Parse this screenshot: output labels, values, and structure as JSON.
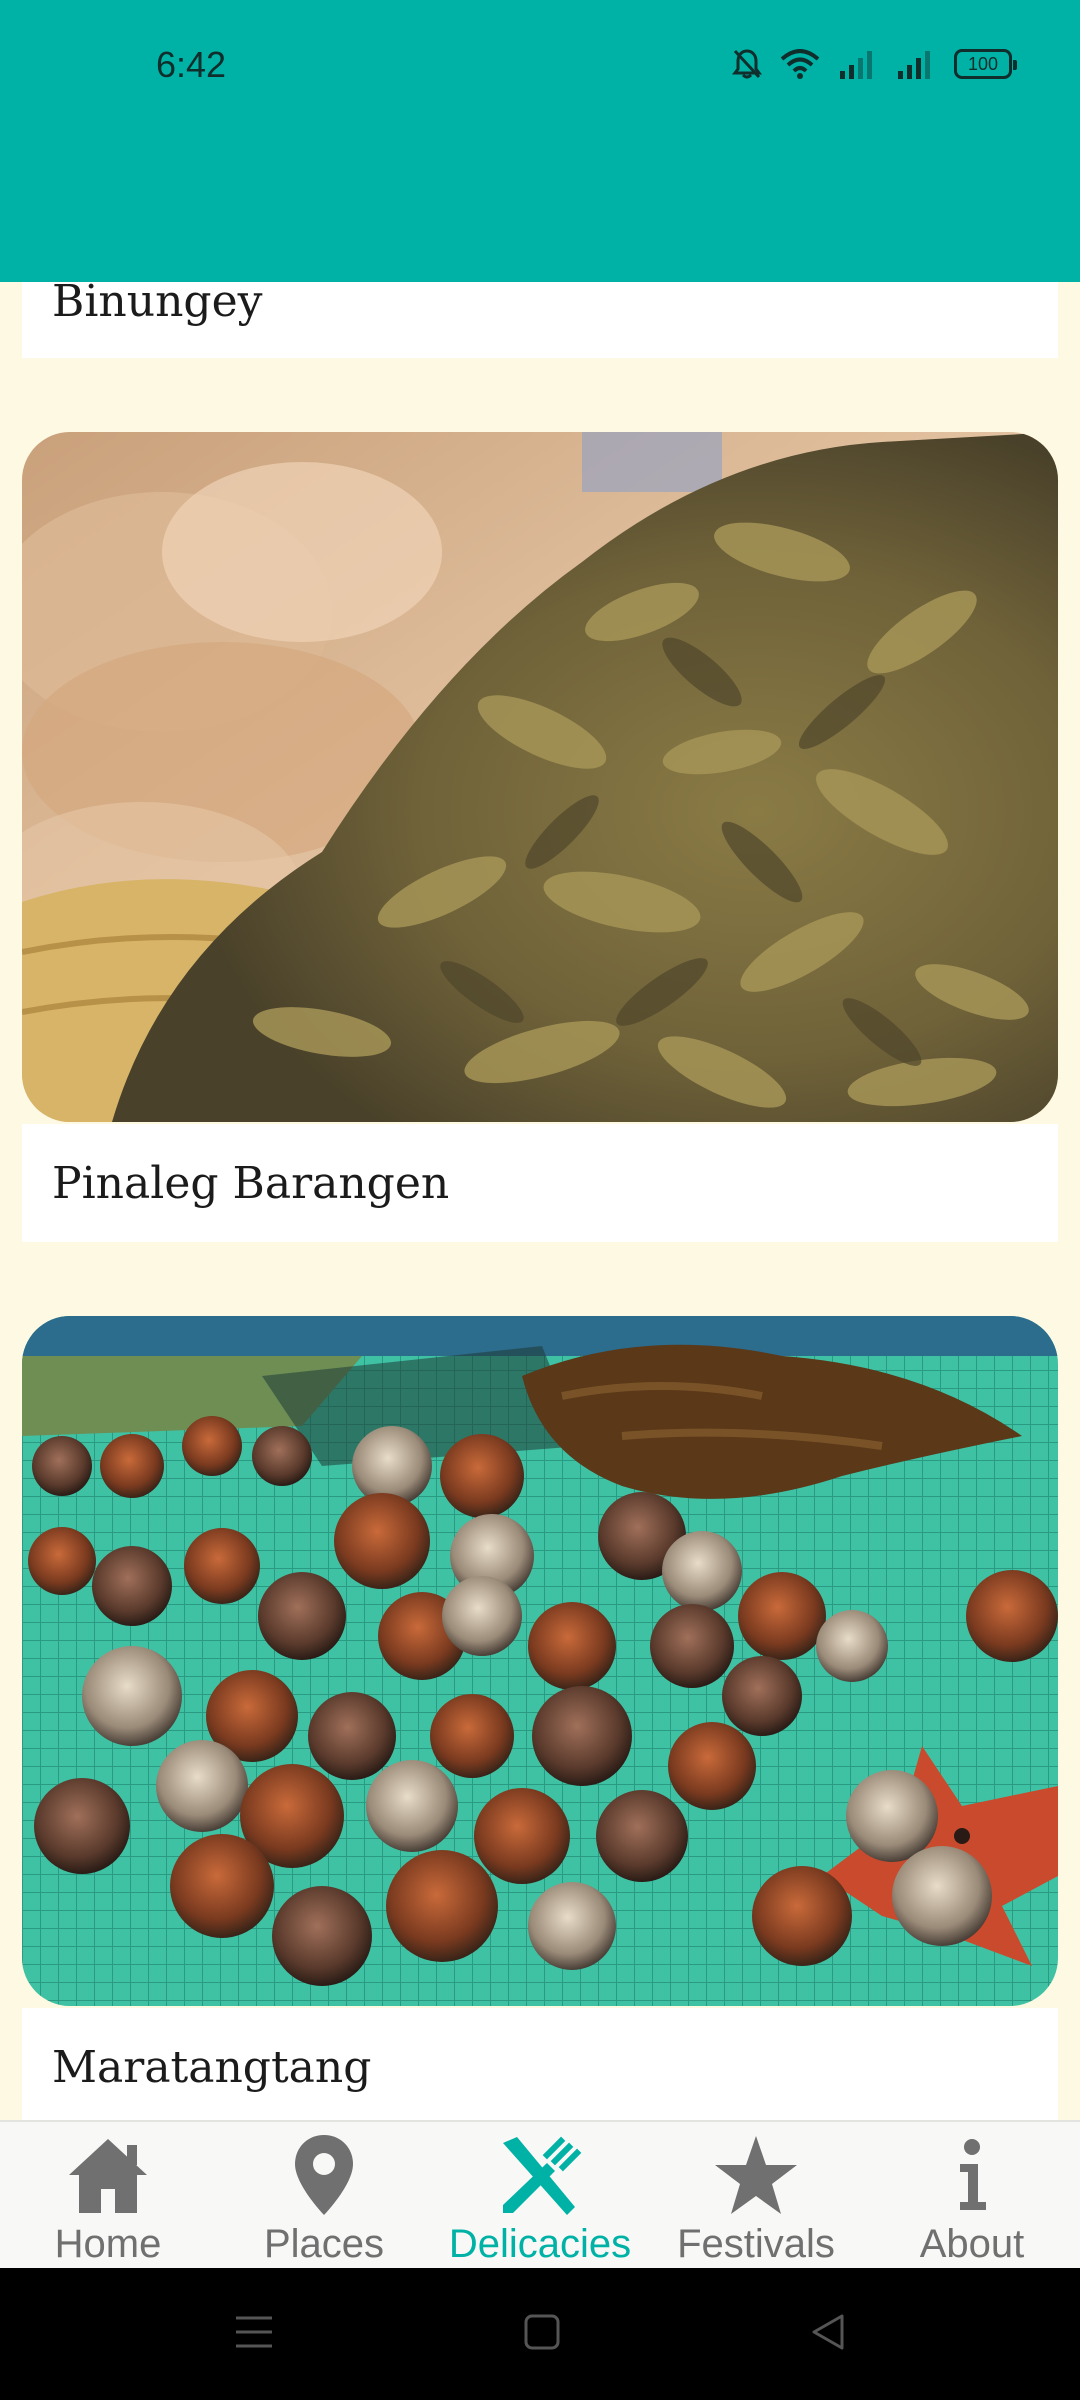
{
  "status_bar": {
    "time": "6:42",
    "battery": "100",
    "icons": [
      "mute-bell-icon",
      "wifi-icon",
      "signal-icon",
      "signal-icon",
      "battery-icon"
    ]
  },
  "colors": {
    "accent": "#00b2a6",
    "background": "#fdf9e3",
    "nav_inactive": "#707070"
  },
  "delicacies": [
    {
      "title": "Binungey",
      "image": "partially-scrolled"
    },
    {
      "title": "Pinaleg Barangen",
      "image": "dried-fish-photo"
    },
    {
      "title": "Maratangtang",
      "image": "sea-urchins-photo"
    }
  ],
  "bottom_nav": {
    "items": [
      {
        "label": "Home",
        "icon": "home-icon"
      },
      {
        "label": "Places",
        "icon": "map-pin-icon"
      },
      {
        "label": "Delicacies",
        "icon": "utensils-icon",
        "active": true
      },
      {
        "label": "Festivals",
        "icon": "star-icon"
      },
      {
        "label": "About",
        "icon": "info-icon"
      }
    ]
  },
  "system_nav": [
    "menu-icon",
    "home-square-icon",
    "back-triangle-icon"
  ]
}
